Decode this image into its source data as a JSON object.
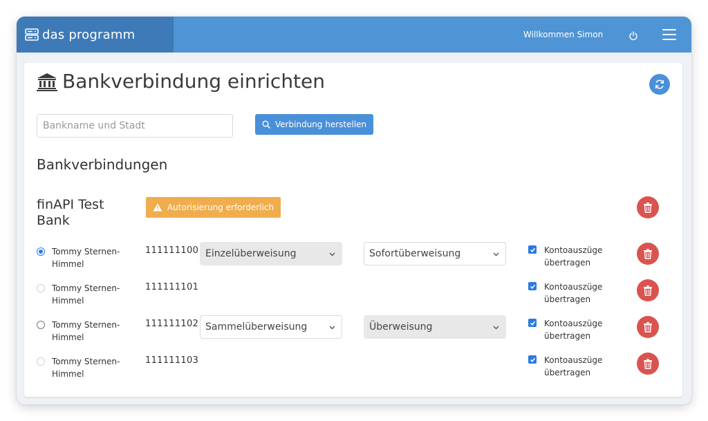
{
  "app": {
    "name": "das programm",
    "welcome": "Willkommen Simon"
  },
  "page": {
    "title": "Bankverbindung einrichten",
    "search_placeholder": "Bankname und Stadt",
    "connect_label": "Verbindung herstellen",
    "section_heading": "Bankverbindungen"
  },
  "bank": {
    "name": "finAPI Test Bank",
    "warning": "Autorisierung erforderlich"
  },
  "accounts": [
    {
      "holder": "Tommy Sternen-Himmel",
      "number": "111111100",
      "radio": "checked",
      "transfer_type": "Einzelüberweisung",
      "payment_method": "Sofortüberweisung",
      "statements_label": "Kontoauszüge übertragen",
      "statements_checked": true
    },
    {
      "holder": "Tommy Sternen-Himmel",
      "number": "111111101",
      "radio": "disabled",
      "statements_label": "Kontoauszüge übertragen",
      "statements_checked": true
    },
    {
      "holder": "Tommy Sternen-Himmel",
      "number": "111111102",
      "radio": "unchecked",
      "transfer_type": "Sammelüberweisung",
      "payment_method": "Überweisung",
      "statements_label": "Kontoauszüge übertragen",
      "statements_checked": true
    },
    {
      "holder": "Tommy Sternen-Himmel",
      "number": "111111103",
      "radio": "disabled",
      "statements_label": "Kontoauszüge übertragen",
      "statements_checked": true
    }
  ],
  "colors": {
    "topbar": "#4f94d4",
    "brand": "#3f7ab8",
    "primary": "#4a90d9",
    "warning": "#f0ad4e",
    "danger": "#d9534f",
    "checkbox": "#2a7ae2"
  },
  "icons": {
    "brand": "server-stack-icon",
    "power": "power-icon",
    "menu": "hamburger-icon",
    "title": "bank-icon",
    "refresh": "refresh-icon",
    "search": "search-icon",
    "warning": "warning-triangle-icon",
    "delete": "trash-icon",
    "select": "chevron-down-icon"
  }
}
